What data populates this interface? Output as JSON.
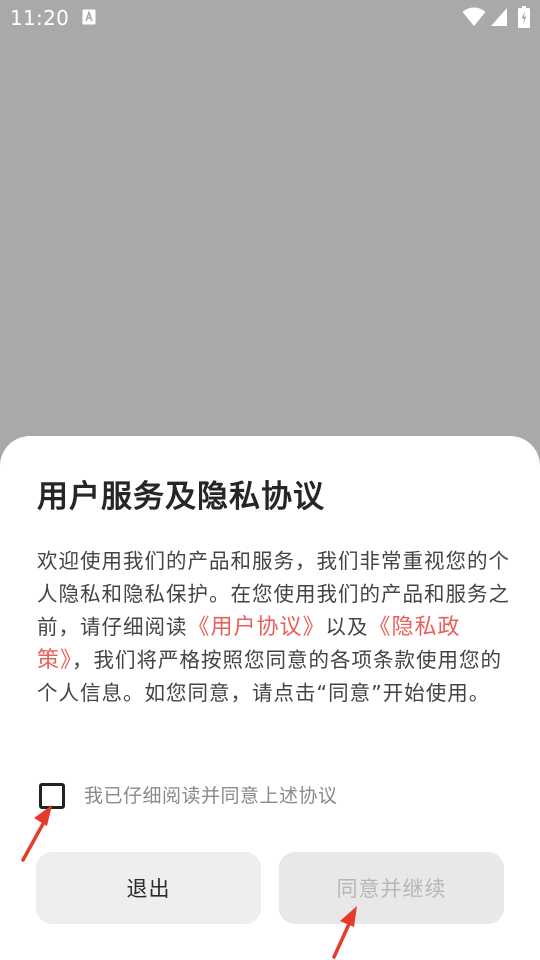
{
  "status_bar": {
    "time": "11:20",
    "icons": [
      "a-notification-icon",
      "wifi-icon",
      "signal-icon",
      "battery-charging-icon"
    ]
  },
  "dialog": {
    "title": "用户服务及隐私协议",
    "body_part1": "欢迎使用我们的产品和服务，我们非常重视您的个人隐私和隐私保护。在您使用我们的产品和服务之前，请仔细阅读",
    "user_agreement_link": "《用户协议》",
    "body_and": "以及",
    "privacy_policy_link": "《隐私政策》",
    "body_part2": "，我们将严格按照您同意的各项条款使用您的个人信息。如您同意，请点击“同意”开始使用。",
    "checkbox_label": "我已仔细阅读并同意上述协议",
    "checkbox_checked": false,
    "exit_button": "退出",
    "agree_button": "同意并继续",
    "agree_button_enabled": false
  },
  "colors": {
    "backdrop": "#a9a9a9",
    "link": "#e9605a",
    "annotation_arrow": "#e53b2a"
  }
}
